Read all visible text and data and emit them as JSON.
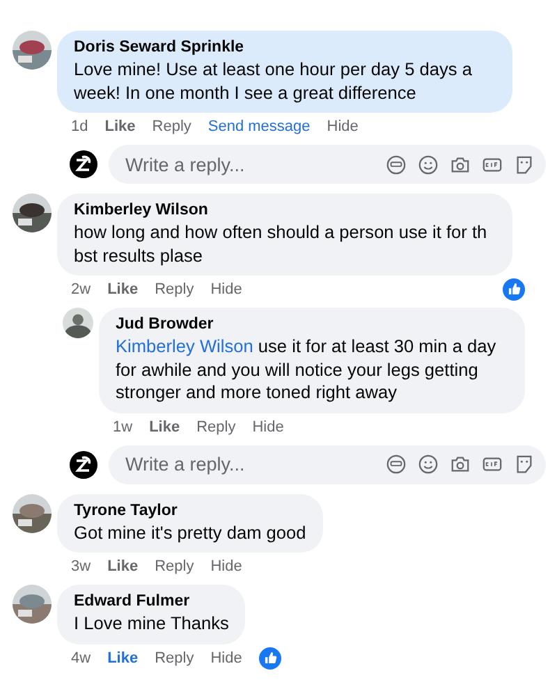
{
  "items": [
    {
      "kind": "comment",
      "author": "Doris Seward Sprinkle",
      "text": "Love mine! Use at least one hour per day 5 days a week! In one month I see a great difference",
      "highlighted": true,
      "time": "1d",
      "actions": [
        {
          "label": "Like",
          "active": false
        },
        {
          "label": "Reply",
          "active": false
        },
        {
          "label": "Send message",
          "active": true
        },
        {
          "label": "Hide",
          "active": false
        }
      ],
      "reacted": false
    },
    {
      "kind": "reply_box",
      "placeholder": "Write a reply..."
    },
    {
      "kind": "comment",
      "author": "Kimberley Wilson",
      "text": "how long and how often should a person use it for th bst results plase",
      "highlighted": false,
      "time": "2w",
      "actions": [
        {
          "label": "Like",
          "active": false
        },
        {
          "label": "Reply",
          "active": false
        },
        {
          "label": "Hide",
          "active": false
        }
      ],
      "reacted": true,
      "children": [
        {
          "author": "Jud Browder",
          "mention": "Kimberley Wilson",
          "text": "use it for at least 30 min a day for awhile and you will notice your legs getting stronger and more toned right away",
          "highlighted": false,
          "time": "1w",
          "actions": [
            {
              "label": "Like",
              "active": false
            },
            {
              "label": "Reply",
              "active": false
            },
            {
              "label": "Hide",
              "active": false
            }
          ],
          "reacted": false
        }
      ]
    },
    {
      "kind": "reply_box",
      "placeholder": "Write a reply..."
    },
    {
      "kind": "comment",
      "author": "Tyrone Taylor",
      "text": "Got mine it's pretty dam good",
      "highlighted": false,
      "time": "3w",
      "actions": [
        {
          "label": "Like",
          "active": false
        },
        {
          "label": "Reply",
          "active": false
        },
        {
          "label": "Hide",
          "active": false
        }
      ],
      "reacted": false
    },
    {
      "kind": "comment",
      "author": "Edward Fulmer",
      "text": "I Love mine Thanks",
      "highlighted": false,
      "time": "4w",
      "actions": [
        {
          "label": "Like",
          "active": true
        },
        {
          "label": "Reply",
          "active": false
        },
        {
          "label": "Hide",
          "active": false
        }
      ],
      "reacted": true
    }
  ]
}
